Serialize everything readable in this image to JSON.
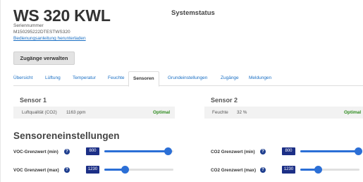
{
  "header": {
    "device_title": "WS 320 KWL",
    "system_status": "Systemstatus",
    "serial_label": "Seriennummer",
    "serial_value": "M150295222DTESTWS320",
    "manual_link": "Bedienungsanleitung herunterladen",
    "access_button": "Zugänge verwalten"
  },
  "tabs": [
    {
      "label": "Übersicht",
      "active": false
    },
    {
      "label": "Lüftung",
      "active": false
    },
    {
      "label": "Temperatur",
      "active": false
    },
    {
      "label": "Feuchte",
      "active": false
    },
    {
      "label": "Sensoren",
      "active": true
    },
    {
      "label": "Grundeinstellungen",
      "active": false
    },
    {
      "label": "Zugänge",
      "active": false
    },
    {
      "label": "Meldungen",
      "active": false
    }
  ],
  "sensors": [
    {
      "title": "Sensor 1",
      "label": "Luftqualität (CO2)",
      "value": "1163 ppm",
      "status": "Optimal"
    },
    {
      "title": "Sensor 2",
      "label": "Feuchte",
      "value": "32 %",
      "status": "Optimal"
    }
  ],
  "settings": {
    "title": "Sensoreneinstellungen",
    "help_icon": "?",
    "items": [
      {
        "label": "VOC-Grenzwert (min)",
        "value": "800",
        "level": 0.92
      },
      {
        "label": "VOC Grenzwert (max)",
        "value": "1230",
        "level": 0.3
      },
      {
        "label": "CO2 Grenzwert (min)",
        "value": "800",
        "level": 0.98
      },
      {
        "label": "CO2 Grenzwert (max)",
        "value": "1230",
        "level": 0.3
      }
    ]
  },
  "colors": {
    "accent": "#2b6fd6",
    "value_box": "#1c2f86",
    "status_ok": "#2e8b1e",
    "link": "#1a6fc4"
  }
}
